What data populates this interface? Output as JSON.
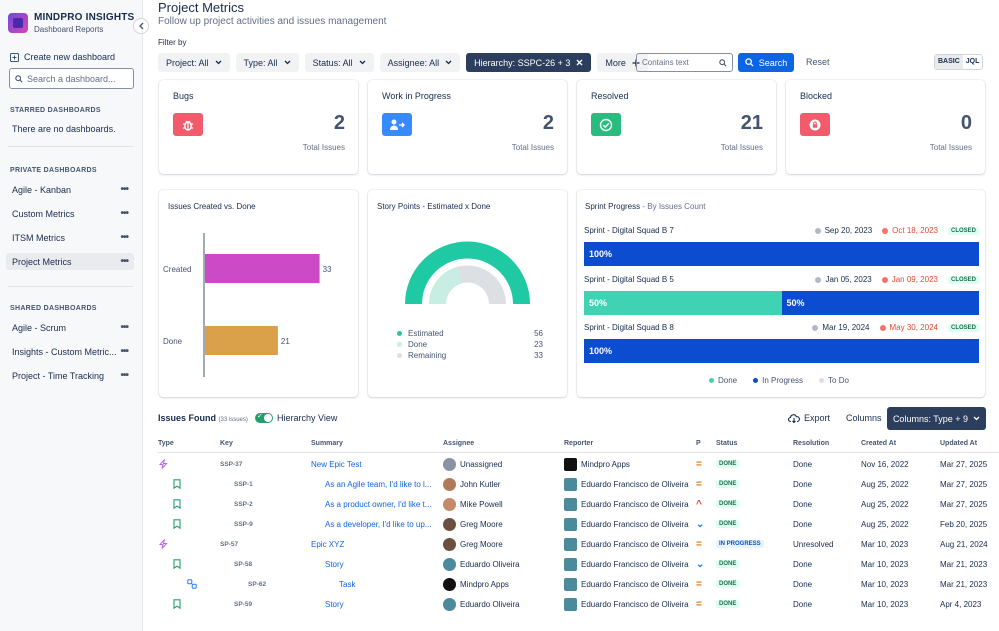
{
  "brand": {
    "title": "MINDPRO INSIGHTS",
    "subtitle": "Dashboard Reports"
  },
  "sidebar": {
    "collapse_icon": "chevron-left-icon",
    "create_label": "Create new dashboard",
    "search_placeholder": "Search a dashboard...",
    "starred_head": "STARRED DASHBOARDS",
    "starred_empty": "There are no dashboards.",
    "private_head": "PRIVATE DASHBOARDS",
    "private_items": [
      "Agile - Kanban",
      "Custom Metrics",
      "ITSM Metrics",
      "Project Metrics"
    ],
    "shared_head": "SHARED DASHBOARDS",
    "shared_items": [
      "Agile - Scrum",
      "Insights - Custom Metric...",
      "Project - Time Tracking"
    ],
    "more_glyph": "•••"
  },
  "header": {
    "title": "Project Metrics",
    "subtitle": "Follow up project activities and issues management"
  },
  "filters": {
    "label": "Filter by",
    "project": "Project: All",
    "type": "Type: All",
    "status": "Status: All",
    "assignee": "Assignee: All",
    "hierarchy": "Hierarchy: SSPC-26 + 3",
    "more": "More",
    "text_placeholder": "Contains text",
    "search": "Search",
    "reset": "Reset",
    "mode_basic": "BASIC",
    "mode_jql": "JQL"
  },
  "kpis": [
    {
      "title": "Bugs",
      "value": "2",
      "foot": "Total Issues",
      "color": "#f15b6c",
      "icon": "bug-icon"
    },
    {
      "title": "Work in Progress",
      "value": "2",
      "foot": "Total Issues",
      "color": "#388bff",
      "icon": "user-arrow-icon"
    },
    {
      "title": "Resolved",
      "value": "21",
      "foot": "Total Issues",
      "color": "#2abb7f",
      "icon": "check-circle-icon"
    },
    {
      "title": "Blocked",
      "value": "0",
      "foot": "Total Issues",
      "color": "#f15b6c",
      "icon": "lock-icon"
    }
  ],
  "created_vs_done": {
    "title": "Issues Created vs. Done",
    "categories": [
      "Created",
      "Done"
    ],
    "values": [
      33,
      21
    ],
    "colors": [
      "#cd4ac7",
      "#dba14a"
    ]
  },
  "story_points": {
    "title": "Story Points - Estimated x Done",
    "legend": [
      {
        "label": "Estimated",
        "value": "56",
        "color": "#1fc9a3"
      },
      {
        "label": "Done",
        "value": "23",
        "color": "#c8eee4"
      },
      {
        "label": "Remaining",
        "value": "33",
        "color": "#dcdfe4"
      }
    ]
  },
  "sprint": {
    "title": "Sprint Progress",
    "subtitle": "- By Issues Count",
    "closed_label": "CLOSED",
    "rows": [
      {
        "name": "Sprint - Digital Squad B 7",
        "start": "Sep 20, 2023",
        "end": "Oct 18, 2023",
        "segments": [
          {
            "label": "100%",
            "value": 100,
            "color": "#0c4cd0"
          }
        ]
      },
      {
        "name": "Sprint - Digital Squad B 5",
        "start": "Jan 05, 2023",
        "end": "Jan 09, 2023",
        "segments": [
          {
            "label": "50%",
            "value": 50,
            "color": "#3fd3b4"
          },
          {
            "label": "50%",
            "value": 50,
            "color": "#0c4cd0"
          }
        ]
      },
      {
        "name": "Sprint - Digital Squad B 8",
        "start": "Mar 19, 2024",
        "end": "May 30, 2024",
        "segments": [
          {
            "label": "100%",
            "value": 100,
            "color": "#0c4cd0"
          }
        ]
      }
    ],
    "legend": [
      {
        "label": "Done",
        "color": "#3fd3b4"
      },
      {
        "label": "In Progress",
        "color": "#0c4cd0"
      },
      {
        "label": "To Do",
        "color": "#dcdfe4"
      }
    ]
  },
  "issues": {
    "title": "Issues Found",
    "count": "(33 issues)",
    "hierarchy_label": "Hierarchy View",
    "export": "Export",
    "columns": "Columns",
    "columns_btn": "Columns: Type + 9",
    "headers": [
      "Type",
      "Key",
      "Summary",
      "Assignee",
      "Reporter",
      "P",
      "Status",
      "Resolution",
      "Created At",
      "Updated At"
    ],
    "rows": [
      {
        "type": "epic",
        "indent": 0,
        "key": "SSP-37",
        "summary": "New Epic Test",
        "assignee": "Unassigned",
        "assignee_av": "#8993a4",
        "reporter": "Mindpro Apps",
        "reporter_av": "#111111",
        "prio": "=",
        "prio_color": "#e2740b",
        "status": "DONE",
        "resolution": "Done",
        "created": "Nov 16, 2022",
        "updated": "Mar 27, 2025"
      },
      {
        "type": "story",
        "indent": 1,
        "key": "SSP-1",
        "summary": "As an Agile team, I'd like to l...",
        "assignee": "John Kutler",
        "assignee_av": "#b07a5a",
        "reporter": "Eduardo Francisco de Oliveira",
        "reporter_av": "#4a8a9a",
        "prio": "=",
        "prio_color": "#e2740b",
        "status": "DONE",
        "resolution": "Done",
        "created": "Aug 25, 2022",
        "updated": "Mar 27, 2025"
      },
      {
        "type": "story",
        "indent": 1,
        "key": "SSP-2",
        "summary": "As a product owner, I'd like t...",
        "assignee": "Mike Powell",
        "assignee_av": "#c48a6a",
        "reporter": "Eduardo Francisco de Oliveira",
        "reporter_av": "#4a8a9a",
        "prio": "^",
        "prio_color": "#e34935",
        "status": "DONE",
        "resolution": "Done",
        "created": "Aug 25, 2022",
        "updated": "Mar 27, 2025"
      },
      {
        "type": "story",
        "indent": 1,
        "key": "SSP-9",
        "summary": "As a developer, I'd like to up...",
        "assignee": "Greg Moore",
        "assignee_av": "#6b5040",
        "reporter": "Eduardo Francisco de Oliveira",
        "reporter_av": "#4a8a9a",
        "prio": "v",
        "prio_color": "#1d7afc",
        "status": "DONE",
        "resolution": "Done",
        "created": "Aug 25, 2022",
        "updated": "Feb 20, 2025"
      },
      {
        "type": "epic",
        "indent": 0,
        "key": "SP-57",
        "summary": "Epic XYZ",
        "assignee": "Greg Moore",
        "assignee_av": "#6b5040",
        "reporter": "Eduardo Francisco de Oliveira",
        "reporter_av": "#4a8a9a",
        "prio": "=",
        "prio_color": "#e2740b",
        "status": "IN PROGRESS",
        "resolution": "Unresolved",
        "created": "Mar 10, 2023",
        "updated": "Aug 21, 2024"
      },
      {
        "type": "story",
        "indent": 1,
        "key": "SP-58",
        "summary": "Story",
        "assignee": "Eduardo Oliveira",
        "assignee_av": "#4a8a9a",
        "reporter": "Eduardo Francisco de Oliveira",
        "reporter_av": "#4a8a9a",
        "prio": "v",
        "prio_color": "#1d7afc",
        "status": "DONE",
        "resolution": "Done",
        "created": "Mar 10, 2023",
        "updated": "Mar 21, 2023"
      },
      {
        "type": "subtask",
        "indent": 2,
        "key": "SP-62",
        "summary": "Task",
        "assignee": "Mindpro Apps",
        "assignee_av": "#111111",
        "reporter": "Eduardo Francisco de Oliveira",
        "reporter_av": "#4a8a9a",
        "prio": "=",
        "prio_color": "#e2740b",
        "status": "DONE",
        "resolution": "Done",
        "created": "Mar 10, 2023",
        "updated": "Mar 21, 2023"
      },
      {
        "type": "story",
        "indent": 1,
        "key": "SP-59",
        "summary": "Story",
        "assignee": "Eduardo Oliveira",
        "assignee_av": "#4a8a9a",
        "reporter": "Eduardo Francisco de Oliveira",
        "reporter_av": "#4a8a9a",
        "prio": "=",
        "prio_color": "#e2740b",
        "status": "DONE",
        "resolution": "Done",
        "created": "Mar 10, 2023",
        "updated": "Apr 4, 2023"
      }
    ]
  }
}
